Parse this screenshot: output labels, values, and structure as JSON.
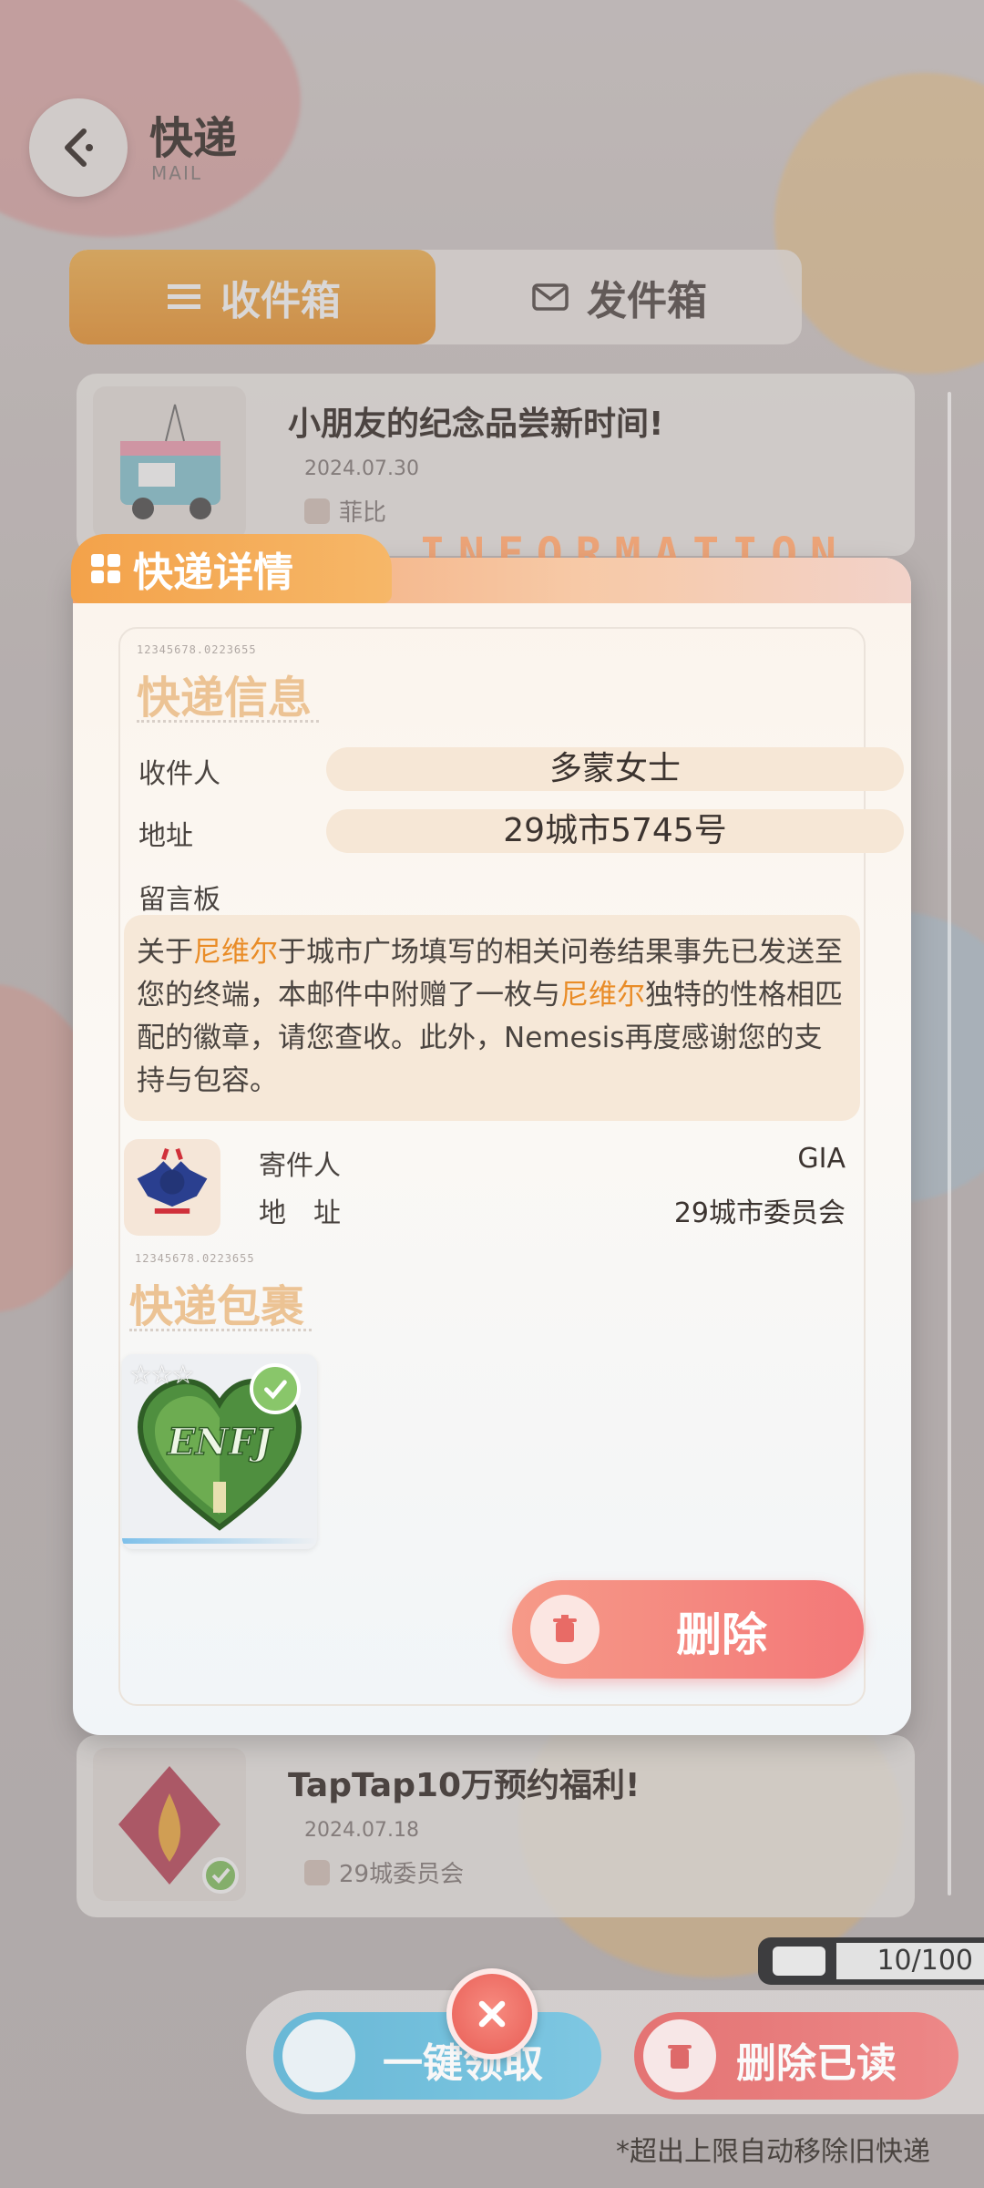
{
  "header": {
    "title": "快递",
    "subtitle": "MAIL"
  },
  "tabs": [
    {
      "label": "收件箱",
      "icon": "list-icon",
      "active": true
    },
    {
      "label": "发件箱",
      "icon": "envelope-icon",
      "active": false
    }
  ],
  "mail_list": [
    {
      "title": "小朋友的纪念品尝新时间!",
      "date": "2024.07.30",
      "sender": "菲比"
    },
    {
      "title": "TapTap10万预约福利!",
      "date": "2024.07.18",
      "sender": "29城委员会"
    }
  ],
  "detail": {
    "tab_label": "快递详情",
    "banner_text": "INFORMATION",
    "code": "12345678.0223655",
    "info_section_title": "快递信息",
    "recipient_label": "收件人",
    "recipient_value": "多蒙女士",
    "address_label": "地址",
    "address_value": "29城市5745号",
    "message_label": "留言板",
    "message_parts": {
      "p1": "关于",
      "hl1": "尼维尔",
      "p2": "于城市广场填写的相关问卷结果事先已发送至您的终端，本邮件中附赠了一枚与",
      "hl2": "尼维尔",
      "p3": "独特的性格相匹配的徽章，请您查收。此外，Nemesis再度感谢您的支持与包容。"
    },
    "sender_label": "寄件人",
    "sender_value": "GIA",
    "sender_address_label": "地　址",
    "sender_address_value": "29城市委员会",
    "package_section_title": "快递包裹",
    "package_item": {
      "badge_text": "ENFJ",
      "rarity": "☆☆☆",
      "claimed": true
    },
    "delete_label": "删除"
  },
  "bottom": {
    "capacity": "10/100",
    "one_click_label": "一键领取",
    "delete_read_label": "删除已读",
    "footnote": "*超出上限自动移除旧快递"
  },
  "colors": {
    "accent_orange": "#f3a24a",
    "highlight": "#e98c27",
    "delete_red": "#f37878"
  }
}
